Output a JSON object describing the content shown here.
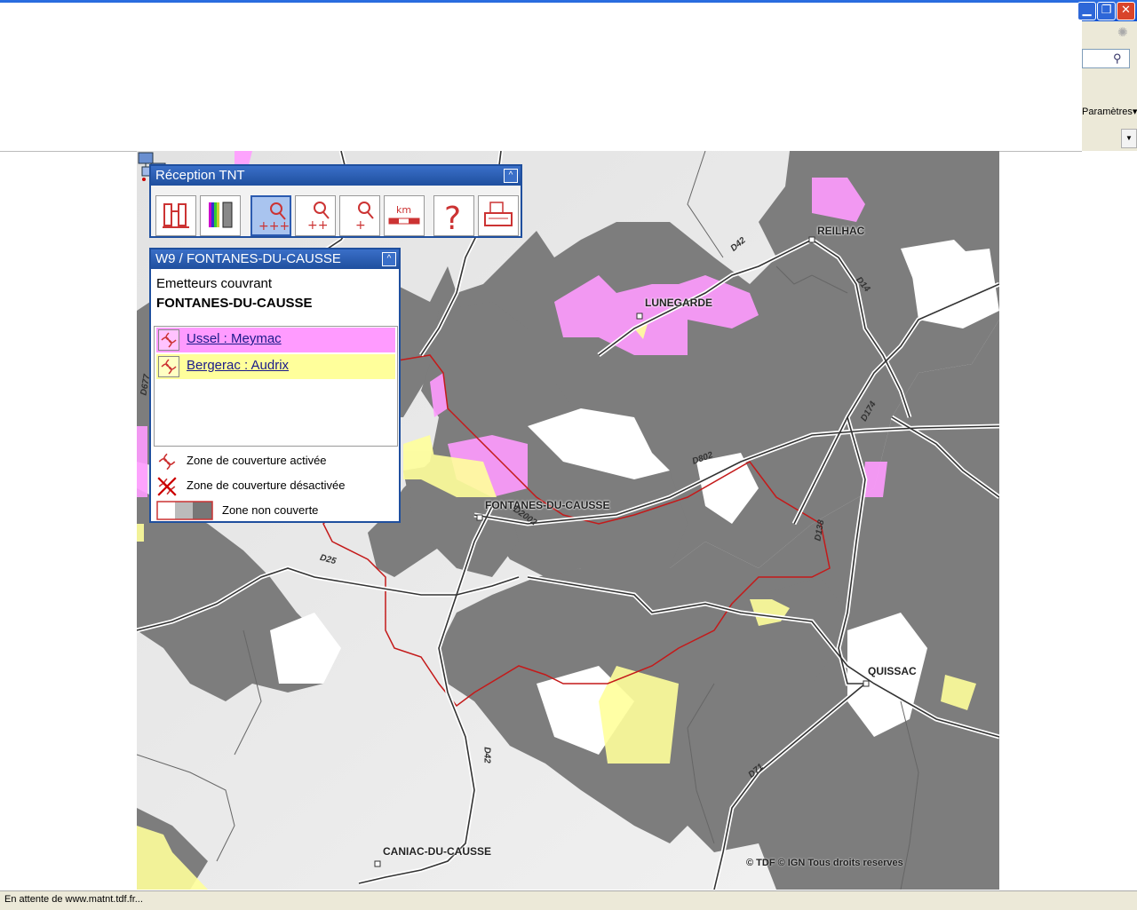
{
  "window": {
    "buttons": {
      "minimize": "▁",
      "maximize": "❐",
      "close": "✕"
    }
  },
  "toolbar_right": {
    "params_label": "Paramètres",
    "search_icon": "search-icon"
  },
  "tool_panel": {
    "title": "Réception TNT",
    "collapse": "^",
    "tools": [
      {
        "name": "binoculars-icon"
      },
      {
        "name": "color-bw-icon"
      },
      {
        "name": "zoom-max-icon",
        "label": "+++",
        "active": true
      },
      {
        "name": "zoom-medium-icon",
        "label": "++"
      },
      {
        "name": "zoom-min-icon",
        "label": "+"
      },
      {
        "name": "scale-icon",
        "label": "km"
      },
      {
        "name": "help-icon"
      },
      {
        "name": "print-icon"
      }
    ]
  },
  "info_panel": {
    "title": "W9 / FONTANES-DU-CAUSSE",
    "collapse": "^",
    "emit_title": "Emetteurs couvrant",
    "emit_town": "FONTANES-DU-CAUSSE",
    "emitters": [
      {
        "label": "Ussel : Meymac",
        "color": "#ff9bff"
      },
      {
        "label": "Bergerac : Audrix",
        "color": "#ffff9b"
      }
    ],
    "legend": [
      {
        "label": "Zone de couverture activée",
        "icon": "coverage-active-icon"
      },
      {
        "label": "Zone de couverture désactivée",
        "icon": "coverage-disabled-icon"
      },
      {
        "label": "Zone non couverte",
        "icon": "uncovered-zone-icon"
      }
    ]
  },
  "map": {
    "places": [
      "REILHAC",
      "LUNEGARDE",
      "FONTANES-DU-CAUSSE",
      "QUISSAC",
      "CANIAC-DU-CAUSSE"
    ],
    "roads": [
      "D42",
      "D14",
      "D174",
      "D802",
      "D2002",
      "D138",
      "D25",
      "D42",
      "D71",
      "D677"
    ],
    "copyright": "© TDF © IGN Tous droits reserves"
  },
  "status": {
    "text": "En attente de www.matnt.tdf.fr..."
  }
}
